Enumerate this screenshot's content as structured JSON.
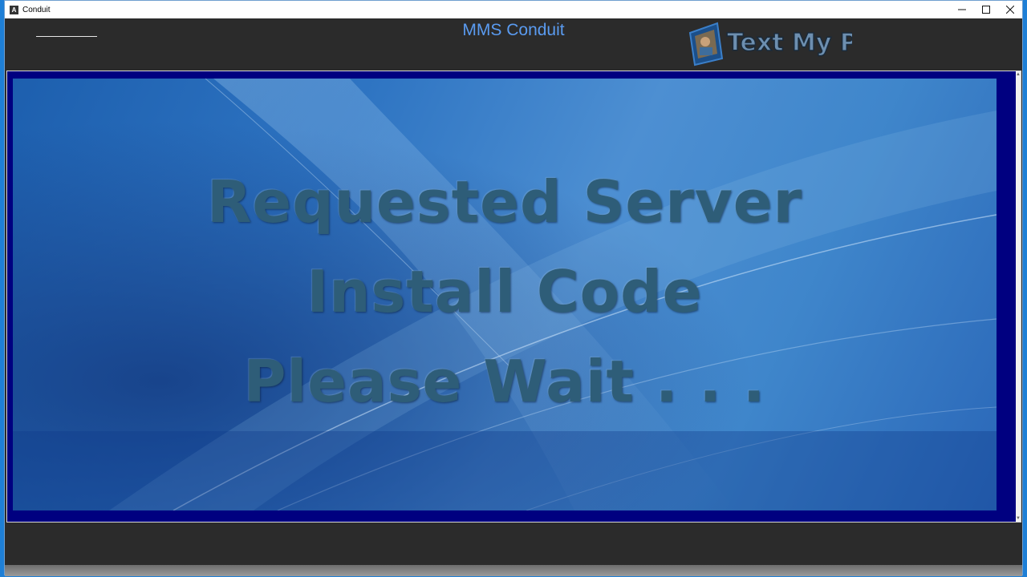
{
  "window": {
    "title": "Conduit",
    "app_icon_glyph": "A",
    "controls": {
      "minimize_icon": "minimize-icon",
      "maximize_icon": "maximize-icon",
      "close_icon": "close-icon"
    }
  },
  "header": {
    "app_title": "MMS Conduit",
    "logo_text": "Text My Photos"
  },
  "splash": {
    "lines": [
      "Requested Server",
      "Install Code",
      "Please Wait . . ."
    ]
  },
  "colors": {
    "title_accent": "#5a9bf0",
    "frame_bg": "#000080",
    "chrome_bg": "#2b2b2b",
    "message_text": "#2e5d78"
  }
}
